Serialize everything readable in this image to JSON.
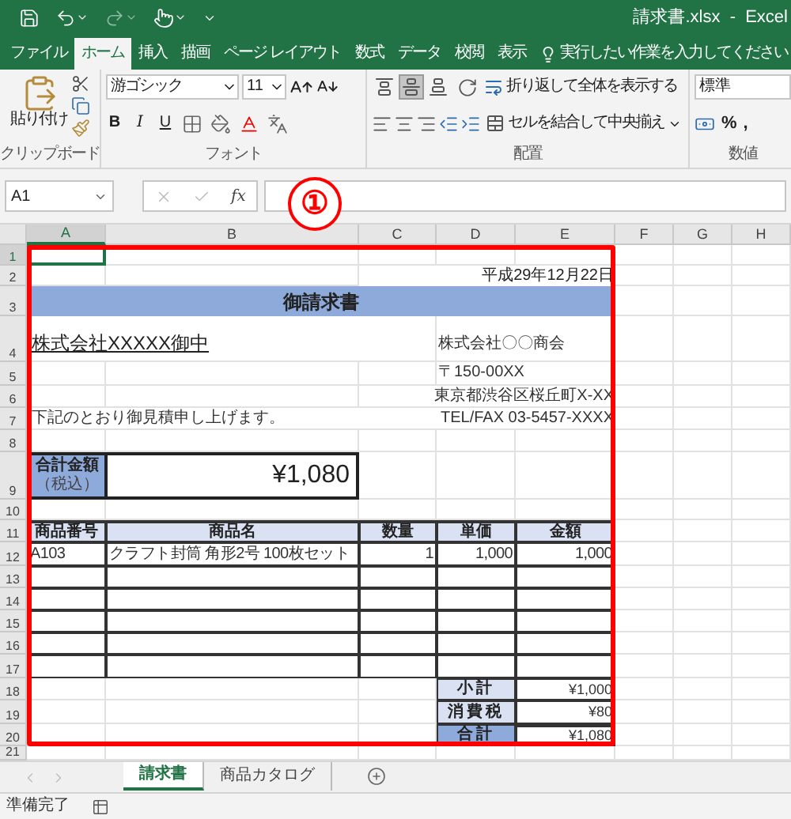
{
  "window": {
    "title": "請求書.xlsx  -  Excel"
  },
  "menu_tabs": [
    {
      "label": "ファイル",
      "selected": false
    },
    {
      "label": "ホーム",
      "selected": true
    },
    {
      "label": "挿入",
      "selected": false
    },
    {
      "label": "描画",
      "selected": false
    },
    {
      "label": "ページ レイアウト",
      "selected": false
    },
    {
      "label": "数式",
      "selected": false
    },
    {
      "label": "データ",
      "selected": false
    },
    {
      "label": "校閲",
      "selected": false
    },
    {
      "label": "表示",
      "selected": false
    }
  ],
  "tell_me": {
    "placeholder": "実行したい作業を入力してください"
  },
  "ribbon": {
    "clipboard": {
      "paste_label": "貼り付け",
      "group_label": "クリップボード"
    },
    "font": {
      "font_name": "游ゴシック",
      "font_size": "11",
      "format_buttons": [
        "B",
        "I",
        "U"
      ],
      "group_label": "フォント"
    },
    "alignment": {
      "align_buttons": [
        {
          "selected": false
        },
        {
          "selected": true
        },
        {
          "selected": false
        }
      ],
      "wrap_text": "折り返して全体を表示する",
      "merge_center": "セルを結合して中央揃え",
      "group_label": "配置"
    },
    "number": {
      "format": "標準",
      "symbols": [
        "%",
        ","
      ],
      "group_label": "数値"
    }
  },
  "formula_bar": {
    "name_box": "A1",
    "function_label": "fx"
  },
  "annotation": {
    "marker": "①"
  },
  "sheet": {
    "columns": [
      {
        "label": "A",
        "selected": true
      },
      {
        "label": "B",
        "selected": false
      },
      {
        "label": "C",
        "selected": false
      },
      {
        "label": "D",
        "selected": false
      },
      {
        "label": "E",
        "selected": false
      },
      {
        "label": "F",
        "selected": false
      },
      {
        "label": "G",
        "selected": false
      },
      {
        "label": "H",
        "selected": false
      }
    ],
    "row_numbers": [
      {
        "label": "1",
        "selected": true
      },
      {
        "label": "2",
        "selected": false
      },
      {
        "label": "3",
        "selected": false
      },
      {
        "label": "4",
        "selected": false
      },
      {
        "label": "5",
        "selected": false
      },
      {
        "label": "6",
        "selected": false
      },
      {
        "label": "7",
        "selected": false
      },
      {
        "label": "8",
        "selected": false
      },
      {
        "label": "9",
        "selected": false
      },
      {
        "label": "10",
        "selected": false
      },
      {
        "label": "11",
        "selected": false
      },
      {
        "label": "12",
        "selected": false
      },
      {
        "label": "13",
        "selected": false
      },
      {
        "label": "14",
        "selected": false
      },
      {
        "label": "15",
        "selected": false
      },
      {
        "label": "16",
        "selected": false
      },
      {
        "label": "17",
        "selected": false
      },
      {
        "label": "18",
        "selected": false
      },
      {
        "label": "19",
        "selected": false
      },
      {
        "label": "20",
        "selected": false
      },
      {
        "label": "21",
        "selected": false
      }
    ],
    "invoice": {
      "date": "平成29年12月22日",
      "title": "御請求書",
      "customer": "株式会社XXXXX御中",
      "sender": [
        "株式会社〇〇商会",
        "〒150-00XX",
        "東京都渋谷区桜丘町X-XX",
        "TEL/FAX 03-5457-XXXX"
      ],
      "message": "下記のとおり御見積申し上げます。",
      "total": {
        "label": "合計金額",
        "note": "（税込）",
        "amount": "¥1,080"
      },
      "table": {
        "columns": [
          "商品番号",
          "商品名",
          "数量",
          "単価",
          "金額"
        ],
        "rows": [
          {
            "cells": [
              "A103",
              "クラフト封筒 角形2号 100枚セット",
              "1",
              "1,000",
              "1,000"
            ]
          }
        ]
      },
      "summary": [
        {
          "label": "小計",
          "value": "¥1,000",
          "kind": "line"
        },
        {
          "label": "消費税",
          "value": "¥80",
          "kind": "line"
        },
        {
          "label": "合計",
          "value": "¥1,080",
          "kind": "total"
        }
      ]
    }
  },
  "sheet_tabs": [
    {
      "label": "請求書",
      "selected": true
    },
    {
      "label": "商品カタログ",
      "selected": false
    }
  ],
  "status_bar": {
    "text": "準備完了"
  }
}
